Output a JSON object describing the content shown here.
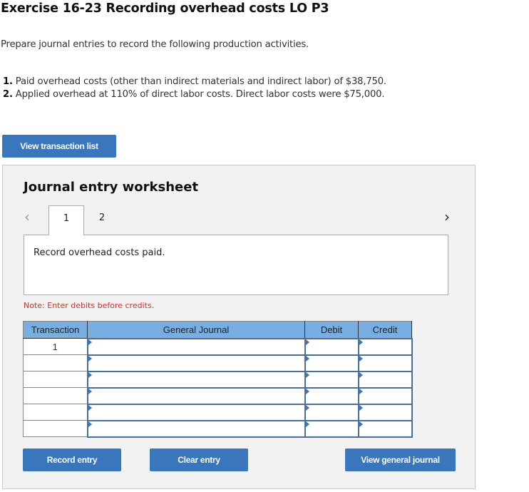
{
  "header": {
    "title": "Exercise 16-23 Recording overhead costs LO P3",
    "intro": "Prepare journal entries to record the following production activities."
  },
  "items": [
    {
      "num": "1.",
      "text": "Paid overhead costs (other than indirect materials and indirect labor) of $38,750."
    },
    {
      "num": "2.",
      "text": "Applied overhead at 110% of direct labor costs. Direct labor costs were $75,000."
    }
  ],
  "buttons": {
    "view_transaction_list": "View transaction list",
    "record_entry": "Record entry",
    "clear_entry": "Clear entry",
    "view_general_journal": "View general journal"
  },
  "worksheet": {
    "title": "Journal entry worksheet",
    "tabs": [
      {
        "label": "1",
        "active": true
      },
      {
        "label": "2",
        "active": false
      }
    ],
    "prev_icon": "chevron-left-icon",
    "next_icon": "chevron-right-icon",
    "prompt": "Record overhead costs paid.",
    "note": "Note: Enter debits before credits."
  },
  "journal": {
    "columns": [
      "Transaction",
      "General Journal",
      "Debit",
      "Credit"
    ],
    "rows": [
      {
        "transaction": "1",
        "account": "",
        "debit": "",
        "credit": ""
      },
      {
        "transaction": "",
        "account": "",
        "debit": "",
        "credit": ""
      },
      {
        "transaction": "",
        "account": "",
        "debit": "",
        "credit": ""
      },
      {
        "transaction": "",
        "account": "",
        "debit": "",
        "credit": ""
      },
      {
        "transaction": "",
        "account": "",
        "debit": "",
        "credit": ""
      },
      {
        "transaction": "",
        "account": "",
        "debit": "",
        "credit": ""
      }
    ]
  },
  "colors": {
    "button_blue": "#3a76bb",
    "header_blue": "#79aee3",
    "note_red": "#c0392b",
    "panel_gray": "#f2f2f2"
  }
}
